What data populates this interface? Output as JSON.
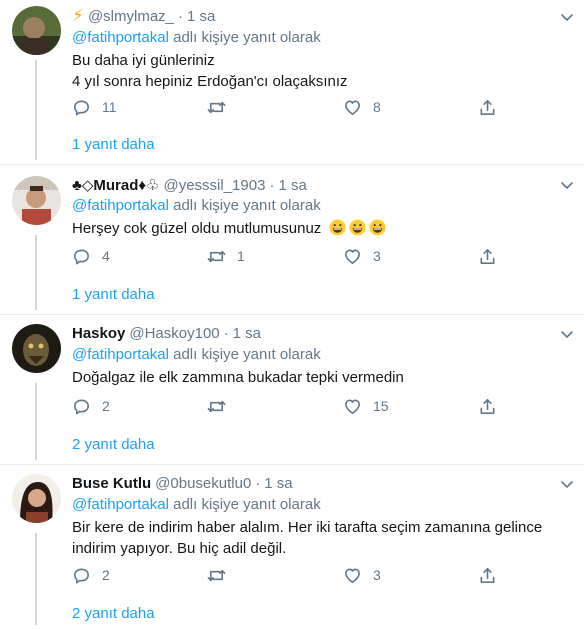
{
  "tweets": [
    {
      "name": "",
      "name_prefix_icon": "lightning-icon",
      "handle": "@slmylmaz_",
      "time": "1 sa",
      "reply_mention": "@fatihportakal",
      "reply_suffix": "adlı kişiye yanıt olarak",
      "lines": [
        "Bu daha iyi günleriniz",
        "4 yıl sonra hepiniz Erdoğan'cı olaçaksınız"
      ],
      "replies": "11",
      "retweets": "",
      "likes": "8",
      "more_replies": "1 yanıt daha"
    },
    {
      "name": "♣◇Murad♦♧",
      "handle": "@yesssil_1903",
      "time": "1 sa",
      "reply_mention": "@fatihportakal",
      "reply_suffix": "adlı kişiye yanıt olarak",
      "lines": [
        "Herşey cok güzel oldu mutlumusunuz"
      ],
      "emoji_count": 3,
      "replies": "4",
      "retweets": "1",
      "likes": "3",
      "more_replies": "1 yanıt daha"
    },
    {
      "name": "Haskoy",
      "handle": "@Haskoy100",
      "time": "1 sa",
      "reply_mention": "@fatihportakal",
      "reply_suffix": "adlı kişiye yanıt olarak",
      "lines": [
        "Doğalgaz ile elk zammına bukadar tepki vermedin"
      ],
      "replies": "2",
      "retweets": "",
      "likes": "15",
      "more_replies": "2 yanıt daha"
    },
    {
      "name": "Buse Kutlu",
      "handle": "@0busekutlu0",
      "time": "1 sa",
      "reply_mention": "@fatihportakal",
      "reply_suffix": "adlı kişiye yanıt olarak",
      "lines": [
        "Bir kere de indirim haber alalım. Her iki tarafta seçim zamanına gelince",
        "indirim yapıyor. Bu hiç adil değil."
      ],
      "replies": "2",
      "retweets": "",
      "likes": "3",
      "more_replies": "2 yanıt daha"
    }
  ],
  "colors": {
    "accent": "#1da1f2",
    "muted": "#657786",
    "text": "#14171a",
    "divider": "#e6ecf0",
    "lightning": "#ffad1f"
  }
}
